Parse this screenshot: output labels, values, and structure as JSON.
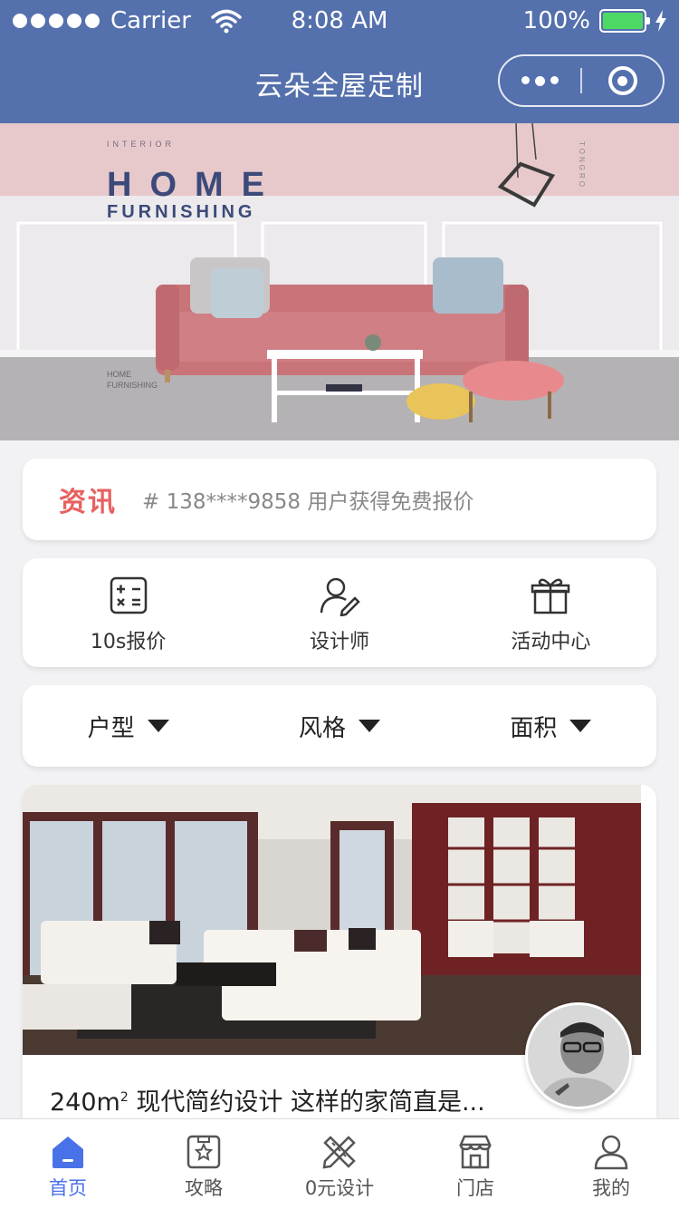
{
  "status_bar": {
    "carrier": "Carrier",
    "time": "8:08 AM",
    "battery": "100%"
  },
  "nav": {
    "title": "云朵全屋定制"
  },
  "colors": {
    "brand": "#5470ad",
    "accent": "#4a72e8",
    "news_tag": "#e86060"
  },
  "banner": {
    "brand_small": "INTERIOR",
    "headline_1": "HOME",
    "headline_2": "FURNISHING",
    "side_text": "TONGRO",
    "sub_1": "HOME",
    "sub_2": "FURNISHING"
  },
  "news": {
    "tag": "资讯",
    "text": "# 138****9858 用户获得免费报价"
  },
  "entries": [
    {
      "label": "10s报价",
      "icon": "calculator-icon"
    },
    {
      "label": "设计师",
      "icon": "designer-icon"
    },
    {
      "label": "活动中心",
      "icon": "gift-icon"
    }
  ],
  "filters": [
    {
      "label": "户型"
    },
    {
      "label": "风格"
    },
    {
      "label": "面积"
    }
  ],
  "case_card": {
    "area": "240m",
    "sup": "2",
    "title": "现代简约设计 这样的家简直是..."
  },
  "tabs": [
    {
      "label": "首页",
      "icon": "home-icon",
      "active": true
    },
    {
      "label": "攻略",
      "icon": "guide-icon",
      "active": false
    },
    {
      "label": "0元设计",
      "icon": "design-icon",
      "active": false
    },
    {
      "label": "门店",
      "icon": "store-icon",
      "active": false
    },
    {
      "label": "我的",
      "icon": "profile-icon",
      "active": false
    }
  ]
}
